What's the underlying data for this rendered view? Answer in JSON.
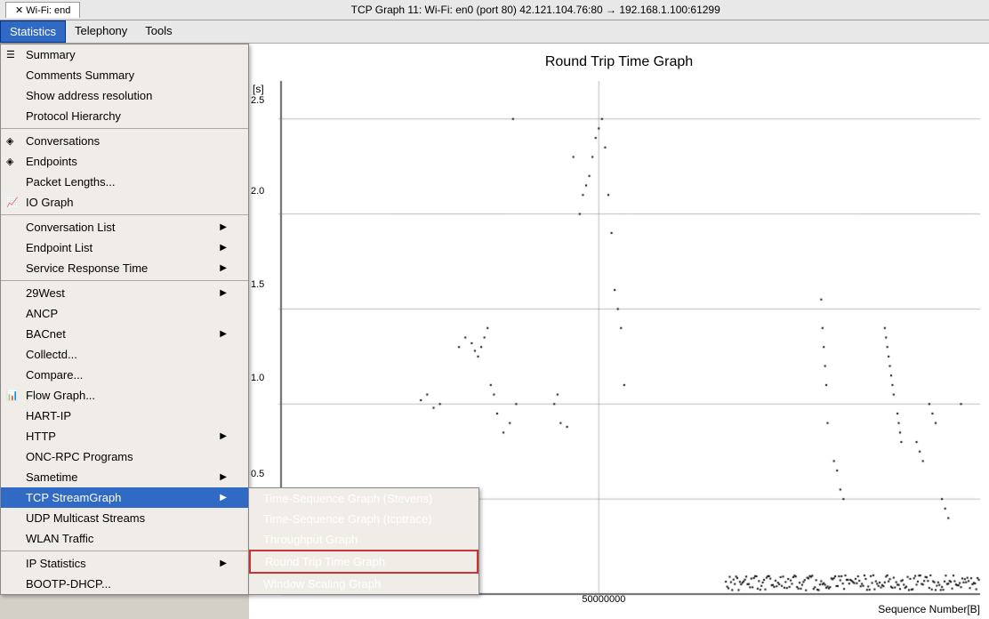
{
  "window": {
    "title": "TCP Graph 11: Wi-Fi: en0 (port 80) 42.121.104.76:80 → 192.168.1.100:61299",
    "tab_label": "Wi-Fi: end"
  },
  "menubar": {
    "items": [
      {
        "id": "statistics",
        "label": "Statistics",
        "active": true
      },
      {
        "id": "telephony",
        "label": "Telephony"
      },
      {
        "id": "tools",
        "label": "Tools"
      }
    ]
  },
  "dropdown": {
    "items": [
      {
        "id": "summary",
        "label": "Summary",
        "icon": "📋",
        "hasArrow": false
      },
      {
        "id": "comments-summary",
        "label": "Comments Summary",
        "hasArrow": false
      },
      {
        "id": "show-address",
        "label": "Show address resolution",
        "hasArrow": false
      },
      {
        "id": "protocol-hierarchy",
        "label": "Protocol Hierarchy",
        "hasArrow": false
      },
      {
        "id": "conversations",
        "label": "Conversations",
        "icon": "🔷",
        "hasArrow": false,
        "separatorAbove": true
      },
      {
        "id": "endpoints",
        "label": "Endpoints",
        "icon": "🔷",
        "hasArrow": false
      },
      {
        "id": "packet-lengths",
        "label": "Packet Lengths...",
        "hasArrow": false
      },
      {
        "id": "io-graph",
        "label": "IO Graph",
        "icon": "📈",
        "hasArrow": false
      },
      {
        "id": "conversation-list",
        "label": "Conversation List",
        "hasArrow": true,
        "separatorAbove": true
      },
      {
        "id": "endpoint-list",
        "label": "Endpoint List",
        "hasArrow": true
      },
      {
        "id": "service-response-time",
        "label": "Service Response Time",
        "hasArrow": true
      },
      {
        "id": "29west",
        "label": "29West",
        "hasArrow": true,
        "separatorAbove": true
      },
      {
        "id": "ancp",
        "label": "ANCP",
        "hasArrow": false
      },
      {
        "id": "bacnet",
        "label": "BACnet",
        "hasArrow": true
      },
      {
        "id": "collectd",
        "label": "Collectd...",
        "hasArrow": false
      },
      {
        "id": "compare",
        "label": "Compare...",
        "hasArrow": false
      },
      {
        "id": "flow-graph",
        "label": "Flow Graph...",
        "icon": "📊",
        "hasArrow": false
      },
      {
        "id": "hart-ip",
        "label": "HART-IP",
        "hasArrow": false
      },
      {
        "id": "http",
        "label": "HTTP",
        "hasArrow": true
      },
      {
        "id": "onc-rpc",
        "label": "ONC-RPC Programs",
        "hasArrow": false
      },
      {
        "id": "sametime",
        "label": "Sametime",
        "hasArrow": true
      },
      {
        "id": "tcp-streamgraph",
        "label": "TCP StreamGraph",
        "hasArrow": true,
        "active": true
      },
      {
        "id": "udp-multicast",
        "label": "UDP Multicast Streams",
        "hasArrow": false
      },
      {
        "id": "wlan-traffic",
        "label": "WLAN Traffic",
        "hasArrow": false
      },
      {
        "id": "ip-statistics",
        "label": "IP Statistics",
        "hasArrow": true,
        "separatorAbove": true
      },
      {
        "id": "bootp-dhcp",
        "label": "BOOTP-DHCP...",
        "hasArrow": false
      }
    ]
  },
  "submenu": {
    "items": [
      {
        "id": "time-sequence-stevens",
        "label": "Time-Sequence Graph (Stevens)"
      },
      {
        "id": "time-sequence-tcptrace",
        "label": "Time-Sequence Graph (tcptrace)"
      },
      {
        "id": "throughput-graph",
        "label": "Throughput Graph"
      },
      {
        "id": "round-trip-time",
        "label": "Round Trip Time Graph",
        "highlighted": true,
        "bordered": true
      },
      {
        "id": "window-scaling",
        "label": "Window Scaling Graph"
      }
    ]
  },
  "graph": {
    "title": "Round Trip Time Graph",
    "y_axis_label": "[s]",
    "y_values": [
      "2.5",
      "2.0",
      "1.5",
      "1.0",
      "0.5"
    ],
    "x_axis_label": "Sequence Number[B]",
    "x_values": [
      "50000000"
    ]
  }
}
